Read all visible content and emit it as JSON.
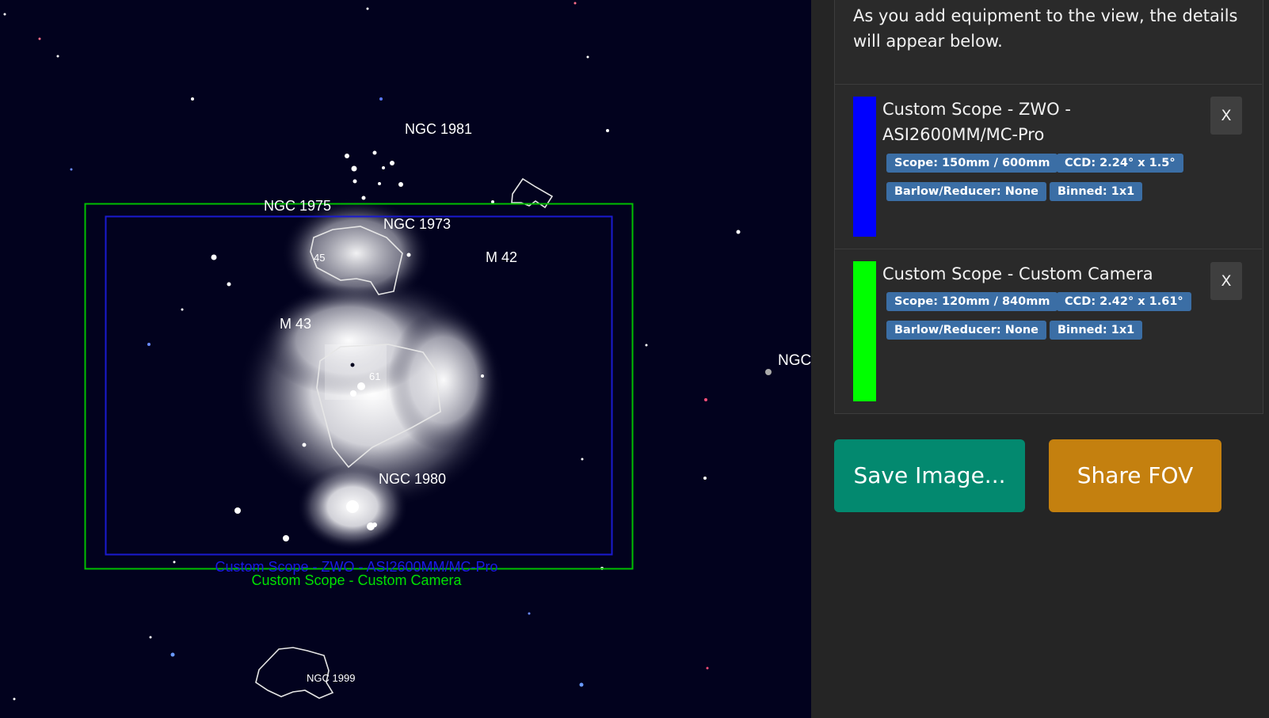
{
  "sky": {
    "objects": [
      {
        "name": "NGC 1981"
      },
      {
        "name": "NGC 1975"
      },
      {
        "name": "NGC 1973"
      },
      {
        "name": "M 42"
      },
      {
        "name": "M 43"
      },
      {
        "name": "NGC 1980"
      },
      {
        "name": "NGC 1999"
      },
      {
        "name": "NGC"
      }
    ],
    "small_labels": [
      "45",
      "61"
    ],
    "fov_labels": [
      {
        "text": "Custom Scope - ZWO - ASI2600MM/MC-Pro",
        "color": "#1a1ae6"
      },
      {
        "text": "Custom Scope - Custom Camera",
        "color": "#00e000"
      }
    ]
  },
  "panel": {
    "intro": "As you add equipment to the view, the details will appear below.",
    "equipment": [
      {
        "title": "Custom Scope - ZWO - ASI2600MM/MC-Pro",
        "color": "#0000ff",
        "scope": "Scope: 150mm / 600mm",
        "ccd": "CCD: 2.24° x 1.5°",
        "barlow": "Barlow/Reducer: None",
        "binned": "Binned: 1x1",
        "remove_label": "X"
      },
      {
        "title": "Custom Scope - Custom Camera",
        "color": "#00ff00",
        "scope": "Scope: 120mm / 840mm",
        "ccd": "CCD: 2.42° x 1.61°",
        "barlow": "Barlow/Reducer: None",
        "binned": "Binned: 1x1",
        "remove_label": "X"
      }
    ],
    "save_button": "Save Image...",
    "share_button": "Share FOV",
    "colors": {
      "save": "#03896f",
      "share": "#c4800f"
    }
  }
}
